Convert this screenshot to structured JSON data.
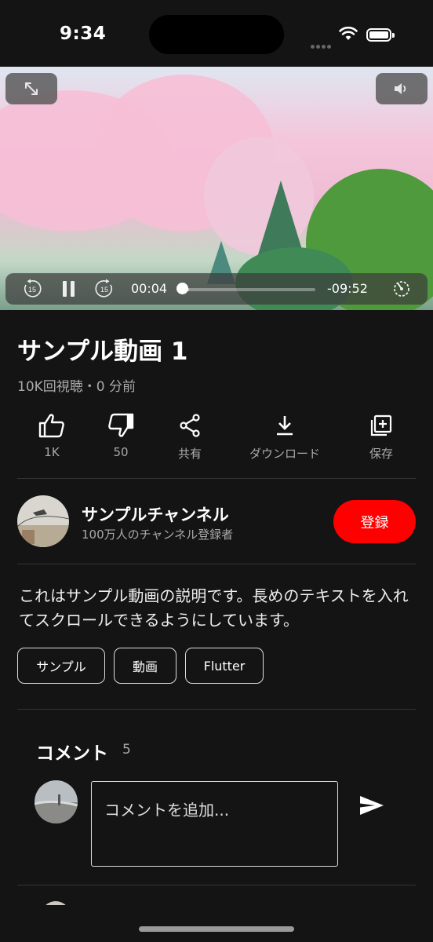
{
  "status_bar": {
    "time": "9:34"
  },
  "player": {
    "current_time": "00:04",
    "remaining_time": "-09:52",
    "progress": 0.007,
    "buffered": 0.06,
    "skip_back_seconds": "15",
    "skip_forward_seconds": "15",
    "icons": [
      "fullscreen-icon",
      "volume-icon",
      "replay-15-icon",
      "pause-icon",
      "forward-15-icon",
      "speed-icon"
    ]
  },
  "video": {
    "title": "サンプル動画 1",
    "meta": "10K回視聴・0 分前"
  },
  "actions": [
    {
      "label": "1K",
      "icon": "thumbs-up-icon"
    },
    {
      "label": "50",
      "icon": "thumbs-down-icon"
    },
    {
      "label": "共有",
      "icon": "share-icon"
    },
    {
      "label": "ダウンロード",
      "icon": "download-icon"
    },
    {
      "label": "保存",
      "icon": "save-playlist-icon"
    }
  ],
  "channel": {
    "name": "サンプルチャンネル",
    "subscribers": "100万人のチャンネル登録者",
    "subscribe_label": "登録"
  },
  "description": "これはサンプル動画の説明です。長めのテキストを入れてスクロールできるようにしています。",
  "tags": [
    "サンプル",
    "動画",
    "Flutter"
  ],
  "comments": {
    "title": "コメント",
    "count": "5",
    "placeholder": "コメントを追加..."
  },
  "colors": {
    "background": "#141414",
    "subscribe": "#ff0000",
    "secondary_text": "#aaaaaa"
  }
}
